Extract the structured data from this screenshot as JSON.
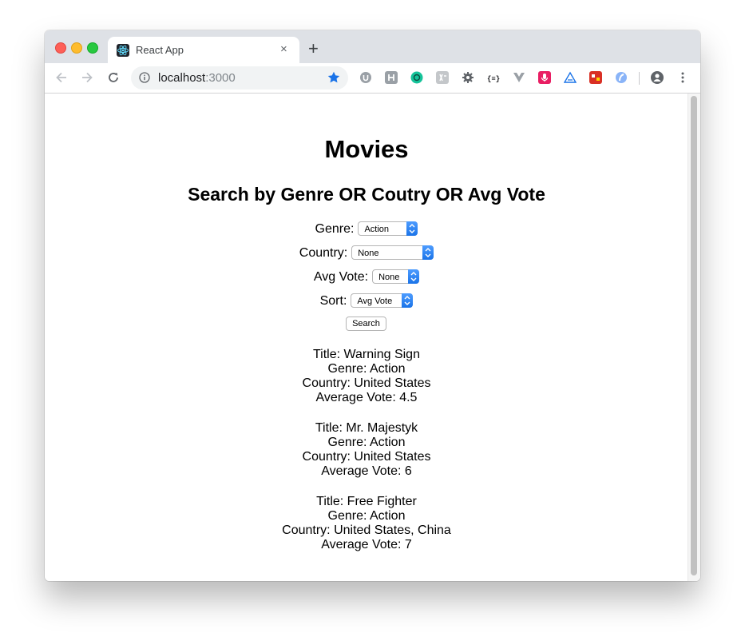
{
  "browser": {
    "tab_title": "React App",
    "tab_close": "×",
    "new_tab": "+",
    "url_host": "localhost",
    "url_port": ":3000",
    "extensions": [
      "ublock-icon",
      "h-icon",
      "grammarly-icon",
      "translate-icon",
      "settings-gear-icon",
      "json-icon",
      "vue-icon",
      "mic-icon",
      "triangle-icon",
      "game-icon",
      "edge-icon"
    ],
    "colors": {
      "tabbar": "#dee1e6",
      "star": "#1a73e8"
    }
  },
  "page": {
    "title": "Movies",
    "subtitle": "Search by Genre OR Coutry OR Avg Vote",
    "filters": [
      {
        "label": "Genre:",
        "value": "Action"
      },
      {
        "label": "Country:",
        "value": "None"
      },
      {
        "label": "Avg Vote:",
        "value": "None"
      },
      {
        "label": "Sort:",
        "value": "Avg Vote"
      }
    ],
    "search_label": "Search",
    "movies": [
      {
        "title": "Title: Warning Sign",
        "genre": "Genre: Action",
        "country": "Country: United States",
        "vote": "Average Vote: 4.5"
      },
      {
        "title": "Title: Mr. Majestyk",
        "genre": "Genre: Action",
        "country": "Country: United States",
        "vote": "Average Vote: 6"
      },
      {
        "title": "Title: Free Fighter",
        "genre": "Genre: Action",
        "country": "Country: United States, China",
        "vote": "Average Vote: 7"
      }
    ]
  }
}
